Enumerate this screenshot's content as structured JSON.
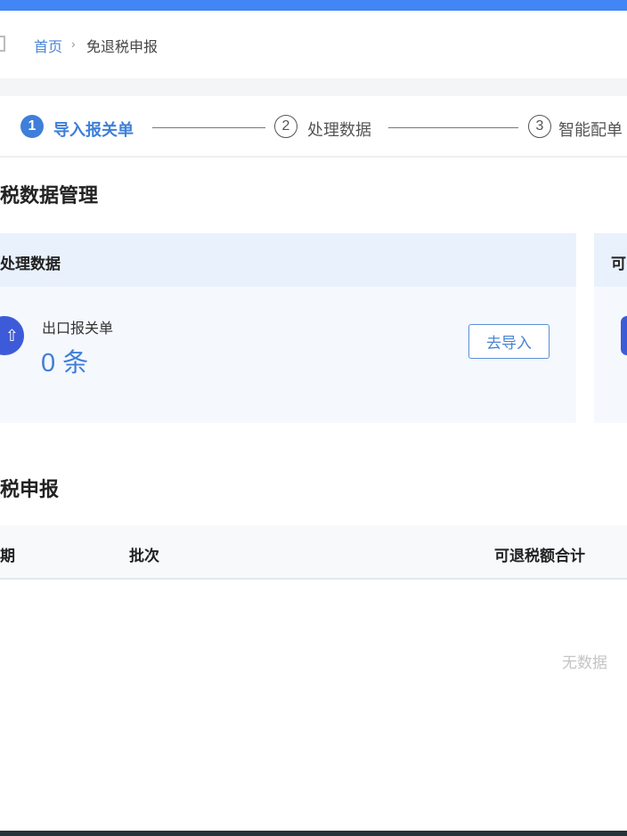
{
  "breadcrumb": {
    "home": "首页",
    "separator": "›",
    "current": "免退税申报"
  },
  "steps": [
    {
      "num": "1",
      "label": "导入报关单"
    },
    {
      "num": "2",
      "label": "处理数据"
    },
    {
      "num": "3",
      "label": "智能配单"
    }
  ],
  "section1": {
    "title": "税数据管理"
  },
  "cards": [
    {
      "title": "处理数据",
      "item_label": "出口报关单",
      "count": "0 条",
      "button": "去导入"
    },
    {
      "title": "可"
    }
  ],
  "section2": {
    "title": "税申报"
  },
  "table": {
    "columns": [
      "期",
      "批次",
      "可退税额合计"
    ],
    "empty_text": "无数据"
  },
  "colors": {
    "primary": "#4285f4",
    "accent_text": "#3f7fd9",
    "icon_bg": "#3d5bd9"
  }
}
